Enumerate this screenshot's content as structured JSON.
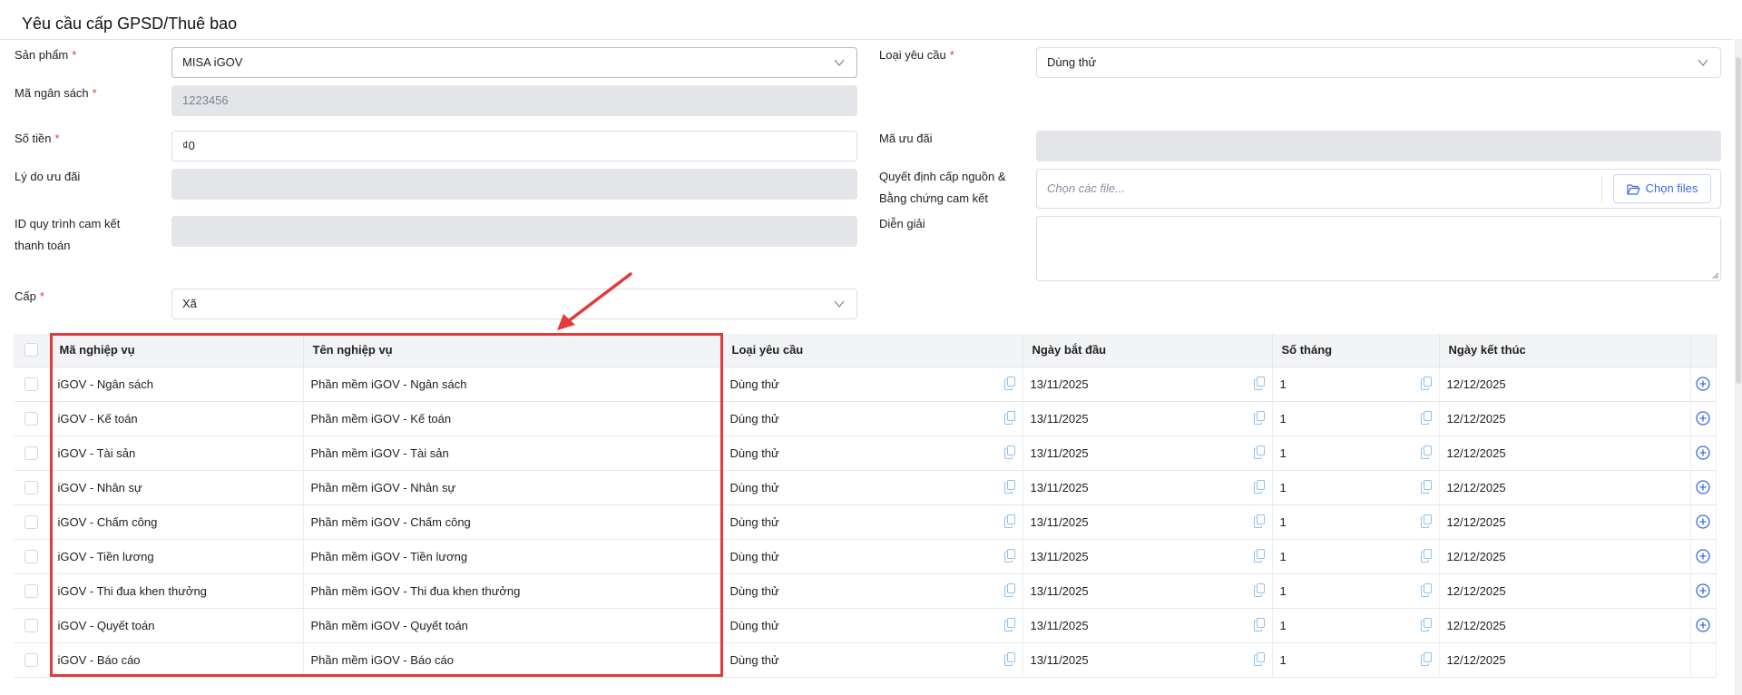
{
  "title": "Yêu cầu cấp GPSD/Thuê bao",
  "form": {
    "product_label": "Sản phẩm",
    "product_value": "MISA iGOV",
    "budget_code_label": "Mã ngân sách",
    "budget_code_value": "1223456",
    "amount_label": "Số tiền",
    "amount_value": "₫0",
    "discount_reason_label": "Lý do ưu đãi",
    "process_id_label_1": "ID quy trình cam kết",
    "process_id_label_2": "thanh toán",
    "level_label": "Cấp",
    "level_value": "Xã",
    "request_type_label": "Loại yêu cầu",
    "request_type_value": "Dùng thử",
    "discount_code_label": "Mã ưu đãi",
    "decision_label_1": "Quyết định cấp nguồn &",
    "decision_label_2": "Bằng chứng cam kết",
    "file_placeholder": "Chọn các file...",
    "file_button": "Chọn files",
    "description_label": "Diễn giải",
    "required_mark": "*"
  },
  "table": {
    "headers": [
      "Mã nghiệp vụ",
      "Tên nghiệp vụ",
      "Loại yêu cầu",
      "Ngày bắt đầu",
      "Số tháng",
      "Ngày kết thúc"
    ],
    "rows": [
      {
        "code": "iGOV - Ngân sách",
        "name": "Phần mềm iGOV - Ngân sách",
        "type": "Dùng thử",
        "start": "13/11/2025",
        "months": "1",
        "end": "12/12/2025",
        "add": true
      },
      {
        "code": "iGOV - Kế toán",
        "name": "Phần mềm iGOV - Kế toán",
        "type": "Dùng thử",
        "start": "13/11/2025",
        "months": "1",
        "end": "12/12/2025",
        "add": true
      },
      {
        "code": "iGOV - Tài sản",
        "name": "Phần mềm iGOV - Tài sản",
        "type": "Dùng thử",
        "start": "13/11/2025",
        "months": "1",
        "end": "12/12/2025",
        "add": true
      },
      {
        "code": "iGOV - Nhân sự",
        "name": "Phần mềm iGOV - Nhân sự",
        "type": "Dùng thử",
        "start": "13/11/2025",
        "months": "1",
        "end": "12/12/2025",
        "add": true
      },
      {
        "code": "iGOV - Chấm công",
        "name": "Phần mềm iGOV - Chấm công",
        "type": "Dùng thử",
        "start": "13/11/2025",
        "months": "1",
        "end": "12/12/2025",
        "add": true
      },
      {
        "code": "iGOV - Tiền lương",
        "name": "Phần mềm iGOV - Tiền lương",
        "type": "Dùng thử",
        "start": "13/11/2025",
        "months": "1",
        "end": "12/12/2025",
        "add": true
      },
      {
        "code": "iGOV - Thi đua khen thưởng",
        "name": "Phần mềm iGOV - Thi đua khen thưởng",
        "type": "Dùng thử",
        "start": "13/11/2025",
        "months": "1",
        "end": "12/12/2025",
        "add": true
      },
      {
        "code": "iGOV - Quyết toán",
        "name": "Phần mềm iGOV - Quyết toán",
        "type": "Dùng thử",
        "start": "13/11/2025",
        "months": "1",
        "end": "12/12/2025",
        "add": true
      },
      {
        "code": "iGOV - Báo cáo",
        "name": "Phần mềm iGOV - Báo cáo",
        "type": "Dùng thử",
        "start": "13/11/2025",
        "months": "1",
        "end": "12/12/2025",
        "add": false
      }
    ]
  },
  "colors": {
    "accent": "#3b6ae0",
    "required": "#e53935",
    "highlight": "#e23b3b"
  }
}
